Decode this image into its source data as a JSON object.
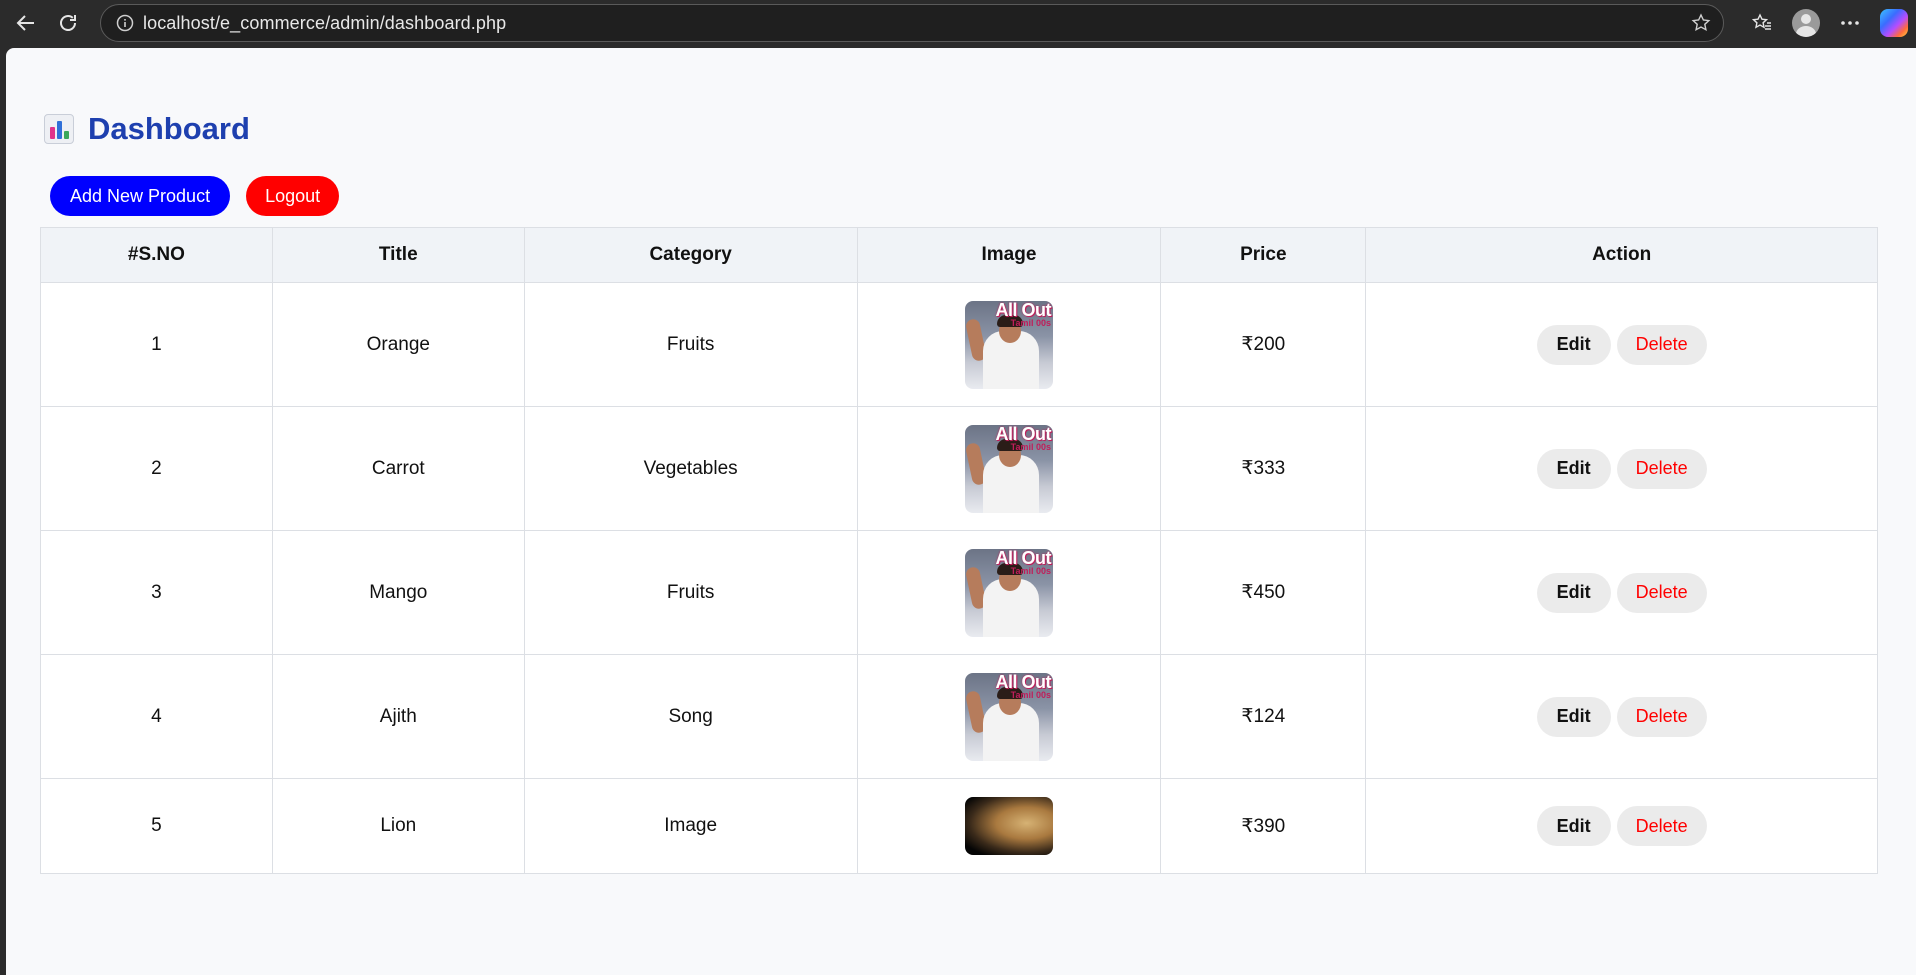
{
  "browser": {
    "url": "localhost/e_commerce/admin/dashboard.php"
  },
  "header": {
    "title": "Dashboard",
    "icon": "bar-chart-icon"
  },
  "toolbar": {
    "add_label": "Add New Product",
    "logout_label": "Logout"
  },
  "table": {
    "columns": [
      "#S.NO",
      "Title",
      "Category",
      "Image",
      "Price",
      "Action"
    ],
    "rows": [
      {
        "sno": "1",
        "title": "Orange",
        "category": "Fruits",
        "price": "₹200",
        "image": "album-cover",
        "image_text": "All Out",
        "image_sub": "Tamil 00s"
      },
      {
        "sno": "2",
        "title": "Carrot",
        "category": "Vegetables",
        "price": "₹333",
        "image": "album-cover",
        "image_text": "All Out",
        "image_sub": "Tamil 00s"
      },
      {
        "sno": "3",
        "title": "Mango",
        "category": "Fruits",
        "price": "₹450",
        "image": "album-cover",
        "image_text": "All Out",
        "image_sub": "Tamil 00s"
      },
      {
        "sno": "4",
        "title": "Ajith",
        "category": "Song",
        "price": "₹124",
        "image": "album-cover",
        "image_text": "All Out",
        "image_sub": "Tamil 00s"
      },
      {
        "sno": "5",
        "title": "Lion",
        "category": "Image",
        "price": "₹390",
        "image": "lion-photo"
      }
    ],
    "edit_label": "Edit",
    "delete_label": "Delete"
  },
  "colors": {
    "title": "#1e40af",
    "add_button": "#0000ff",
    "logout_button": "#ff0000",
    "delete_text": "#ff0000"
  }
}
